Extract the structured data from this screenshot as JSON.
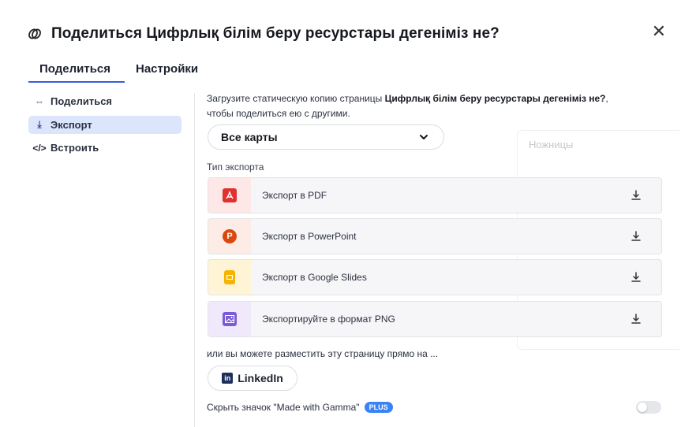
{
  "header": {
    "link_icon": "link-icon",
    "title": "Поделиться Цифрлық білім беру ресурстары дегеніміз не?",
    "close_icon": "close-icon",
    "close_glyph": "✕"
  },
  "tabs": [
    {
      "label": "Поделиться",
      "active": true
    },
    {
      "label": "Настройки",
      "active": false
    }
  ],
  "sidebar": {
    "items": [
      {
        "icon": "share-icon",
        "glyph": "⇔",
        "label": "Поделиться",
        "active": false
      },
      {
        "icon": "download-icon",
        "glyph": "⤓",
        "label": "Экспорт",
        "active": true
      },
      {
        "icon": "code-icon",
        "glyph": "</>",
        "label": "Встроить",
        "active": false
      }
    ]
  },
  "export": {
    "desc_prefix": "Загрузите статическую копию страницы ",
    "desc_doc": "Цифрлық білім беру ресурстары дегеніміз не?",
    "desc_suffix": ",",
    "desc_line2": "чтобы поделиться ею с другими.",
    "select_value": "Все карты",
    "type_label": "Тип экспорта",
    "options": [
      {
        "label": "Экспорт в PDF",
        "icon": "pdf-icon",
        "glyph": "⅄",
        "bg": "#fde7e7",
        "icon_color": "#e03131"
      },
      {
        "label": "Экспорт в PowerPoint",
        "icon": "powerpoint-icon",
        "glyph": "P",
        "bg": "#fdece6",
        "icon_color": "#d9480f"
      },
      {
        "label": "Экспорт в Google Slides",
        "icon": "google-slides-icon",
        "glyph": "▬",
        "bg": "#fff5d6",
        "icon_color": "#f5b400"
      },
      {
        "label": "Экспортируйте в формат PNG",
        "icon": "image-icon",
        "glyph": "▣",
        "bg": "#efe9fb",
        "icon_color": "#7c5cd6"
      }
    ],
    "download_icon": "download-icon"
  },
  "ghost": {
    "label": "Ножницы"
  },
  "share": {
    "label": "или вы можете разместить эту страницу прямо на ...",
    "linkedin_badge": "in",
    "linkedin_label": "LinkedIn"
  },
  "footer": {
    "hide_label": "Скрыть значок \"Made with Gamma\"",
    "plus_badge": "PLUS",
    "toggle_on": false
  }
}
